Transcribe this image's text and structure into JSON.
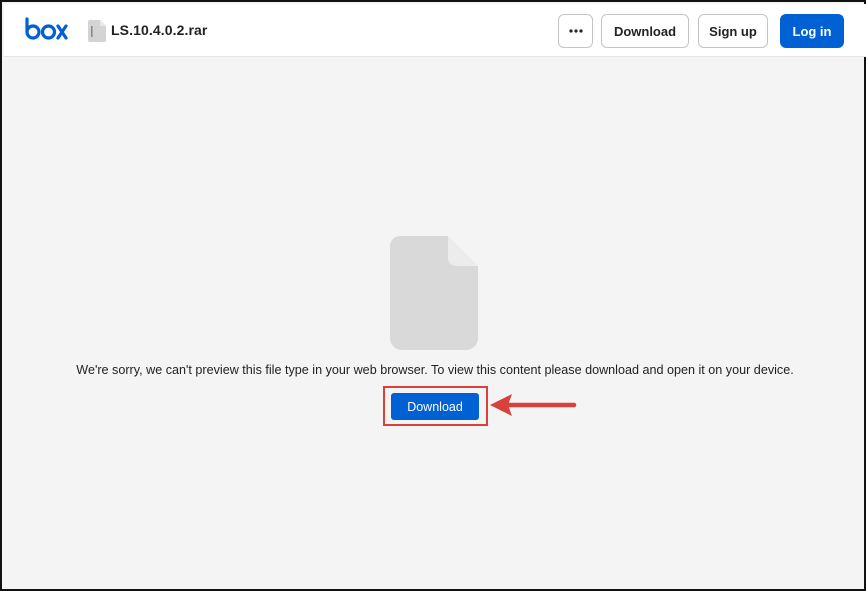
{
  "header": {
    "logo_text": "box",
    "file_name": "LS.10.4.0.2.rar",
    "more_label": "More options",
    "download_label": "Download",
    "signup_label": "Sign up",
    "login_label": "Log in"
  },
  "preview": {
    "message": "We're sorry, we can't preview this file type in your web browser. To view this content please download and open it on your device.",
    "download_label": "Download"
  },
  "colors": {
    "brand_blue": "#0061d5",
    "annotation_red": "#d9413b",
    "background": "#f4f4f4"
  },
  "icons": {
    "logo": "box-logo-icon",
    "file_small": "file-icon",
    "more": "ellipsis-icon",
    "file_large": "file-placeholder-icon",
    "annotation": "red-arrow-icon"
  }
}
